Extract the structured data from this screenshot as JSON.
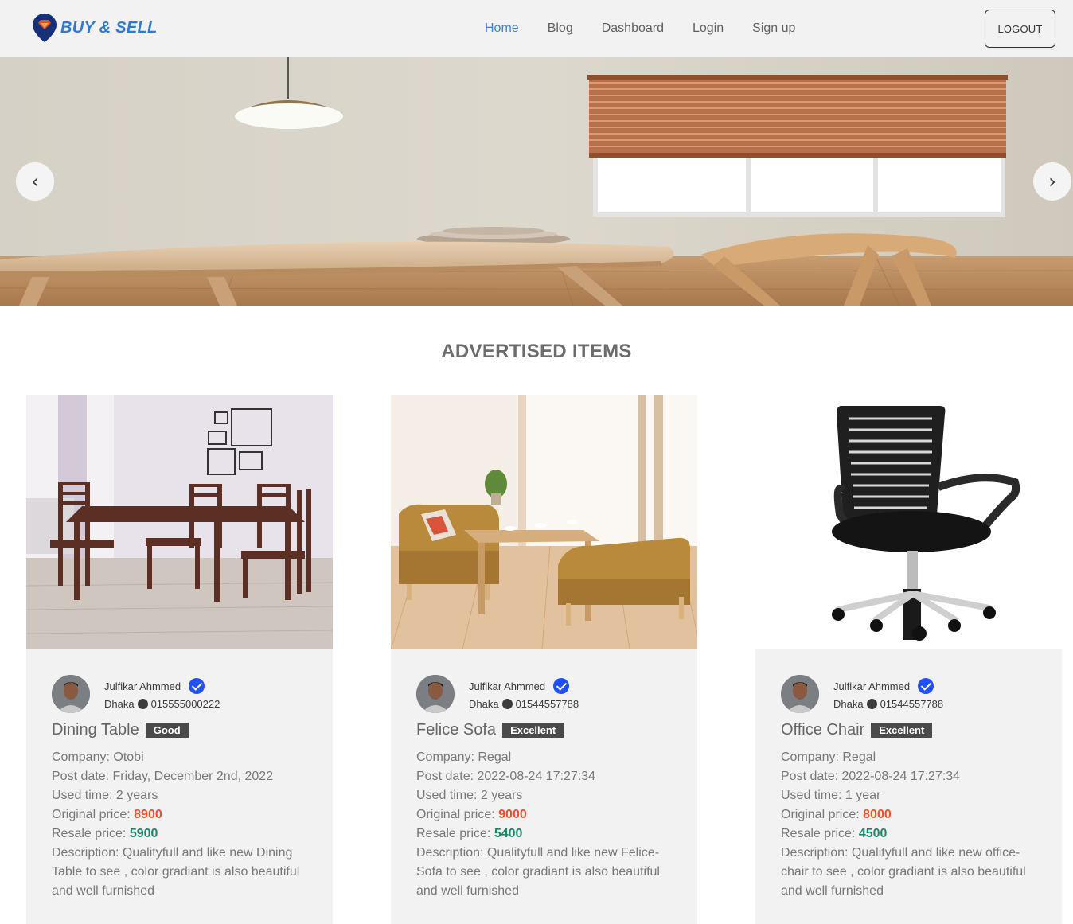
{
  "brand": {
    "name": "BUY & SELL"
  },
  "nav": {
    "links": [
      "Home",
      "Blog",
      "Dashboard",
      "Login",
      "Sign up"
    ],
    "logout": "LOGOUT"
  },
  "carousel": {
    "prev": "‹",
    "next": "›"
  },
  "section": {
    "title": "ADVERTISED ITEMS"
  },
  "labels": {
    "company": "Company: ",
    "post_date": "Post date: ",
    "used_time": "Used time: ",
    "original_price": "Original price: ",
    "resale_price": "Resale price: ",
    "description": "Description: "
  },
  "items": [
    {
      "seller": "Julfikar Ahmmed",
      "location": "Dhaka",
      "phone": "015555000222",
      "title": "Dining Table",
      "condition": "Good",
      "company": "Otobi",
      "post_date": "Friday, December 2nd, 2022",
      "used_time": "2 years",
      "original_price": "8900",
      "resale_price": "5900",
      "description": "Qualityfull and like new Dining Table to see , color gradiant is also beautiful and well furnished"
    },
    {
      "seller": "Julfikar Ahmmed",
      "location": "Dhaka",
      "phone": "01544557788",
      "title": "Felice Sofa",
      "condition": "Excellent",
      "company": "Regal",
      "post_date": "2022-08-24 17:27:34",
      "used_time": "2 years",
      "original_price": "9000",
      "resale_price": "5400",
      "description": "Qualityfull and like new Felice-Sofa to see , color gradiant is also beautiful and well furnished"
    },
    {
      "seller": "Julfikar Ahmmed",
      "location": "Dhaka",
      "phone": "01544557788",
      "title": "Office Chair",
      "condition": "Excellent",
      "company": "Regal",
      "post_date": "2022-08-24 17:27:34",
      "used_time": "1 year",
      "original_price": "8000",
      "resale_price": "4500",
      "description": "Qualityfull and like new office-chair to see , color gradiant is also beautiful and well furnished"
    }
  ],
  "colors": {
    "brand": "#2e7bd6",
    "nav_active": "#3a86d8",
    "original_price": "#f2502c",
    "resale_price": "#168a6a",
    "verified": "#2050ff",
    "badge": "#4a4a4a"
  }
}
